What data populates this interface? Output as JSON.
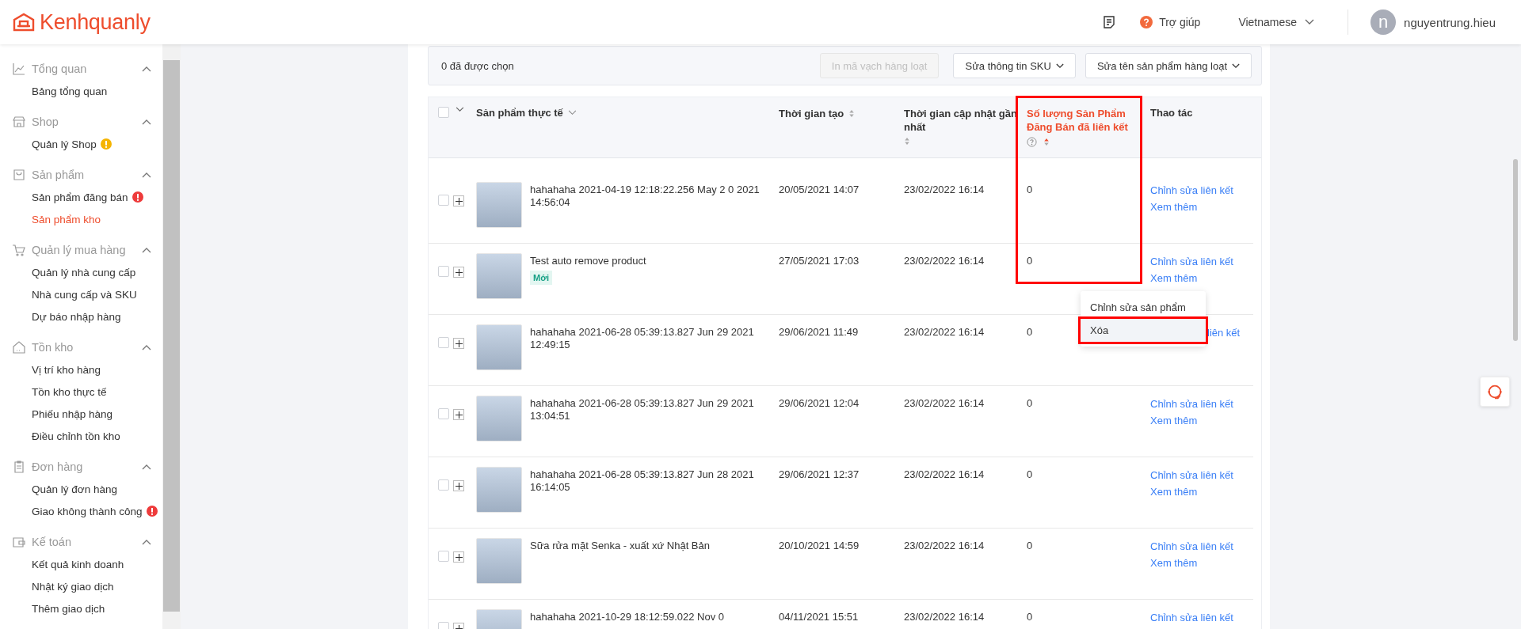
{
  "header": {
    "logo": "Kenhquanly",
    "help": "Trợ giúp",
    "language": "Vietnamese",
    "user": {
      "initial": "n",
      "name": "nguyentrung.hieu"
    }
  },
  "sidebar": {
    "groups": [
      {
        "title": "Tổng quan",
        "kind": "chart",
        "expanded": true,
        "items": [
          {
            "label": "Bảng tổng quan",
            "selected": false
          }
        ]
      },
      {
        "title": "Shop",
        "kind": "shop",
        "expanded": true,
        "items": [
          {
            "label": "Quản lý Shop",
            "selected": false,
            "alert": true,
            "color": "#f5b400"
          }
        ]
      },
      {
        "title": "Sản phẩm",
        "kind": "bag",
        "expanded": true,
        "items": [
          {
            "label": "Sản phẩm đăng bán",
            "selected": false,
            "alert": true,
            "color": "#ee3b3b"
          },
          {
            "label": "Sản phẩm kho",
            "selected": true
          }
        ]
      },
      {
        "title": "Quản lý mua hàng",
        "kind": "cart",
        "expanded": true,
        "items": [
          {
            "label": "Quản lý nhà cung cấp",
            "selected": false
          },
          {
            "label": "Nhà cung cấp và SKU",
            "selected": false
          },
          {
            "label": "Dự báo nhập hàng",
            "selected": false
          }
        ]
      },
      {
        "title": "Tồn kho",
        "kind": "house",
        "expanded": true,
        "items": [
          {
            "label": "Vị trí kho hàng",
            "selected": false
          },
          {
            "label": "Tồn kho thực tế",
            "selected": false
          },
          {
            "label": "Phiếu nhập hàng",
            "selected": false
          },
          {
            "label": "Điều chỉnh tồn kho",
            "selected": false
          }
        ]
      },
      {
        "title": "Đơn hàng",
        "kind": "clipboard",
        "expanded": true,
        "items": [
          {
            "label": "Quản lý đơn hàng",
            "selected": false
          },
          {
            "label": "Giao không thành công",
            "selected": false,
            "alert": true,
            "color": "#ee3b3b"
          }
        ]
      },
      {
        "title": "Kế toán",
        "kind": "wallet",
        "expanded": true,
        "items": [
          {
            "label": "Kết quả kinh doanh",
            "selected": false
          },
          {
            "label": "Nhật ký giao dịch",
            "selected": false
          },
          {
            "label": "Thêm giao dịch",
            "selected": false
          }
        ]
      }
    ]
  },
  "toolbar": {
    "selected_count": "0 đã được chọn",
    "buttons": [
      {
        "label": "In mã vạch hàng loạt",
        "disabled": true,
        "dropdown": false
      },
      {
        "label": "Sửa thông tin SKU",
        "disabled": false,
        "dropdown": true
      },
      {
        "label": "Sửa tên sản phẩm hàng loạt",
        "disabled": false,
        "dropdown": true
      }
    ]
  },
  "table": {
    "select_all": {
      "checked": false
    },
    "columns": [
      {
        "label": "Sản phẩm thực tế",
        "kind": "dropdown",
        "help": false,
        "highlighted": false
      },
      {
        "label": "Thời gian tạo",
        "kind": "sortable",
        "help": false,
        "highlighted": false
      },
      {
        "label": "Thời gian cập nhật gần nhất",
        "kind": "sortable",
        "help": false,
        "highlighted": false
      },
      {
        "label": "Số lượng Sản Phẩm Đăng Bán đã liên kết",
        "kind": "sortable",
        "help": true,
        "highlighted": true
      },
      {
        "label": "Thao tác",
        "kind": "plain",
        "help": false,
        "highlighted": false
      }
    ],
    "rows": [
      {
        "checked": false,
        "name": "hahahaha 2021-04-19 12:18:22.256 May 2 0 2021 14:56:04",
        "created": "20/05/2021 14:07",
        "updated": "23/02/2022 16:14",
        "linked": "0",
        "actions": [
          "Chỉnh sửa liên kết",
          "Xem thêm"
        ]
      },
      {
        "checked": false,
        "name": "Test auto remove product",
        "tag": "Mới",
        "created": "27/05/2021 17:03",
        "updated": "23/02/2022 16:14",
        "linked": "0",
        "actions": [
          "Chỉnh sửa liên kết",
          "Xem thêm"
        ],
        "menu": [
          {
            "label": "Chỉnh sửa sản phẩm",
            "hovered": false,
            "highlighted": false
          },
          {
            "label": "Xóa",
            "hovered": true,
            "highlighted": true
          }
        ]
      },
      {
        "checked": false,
        "name": "hahahaha 2021-06-28 05:39:13.827 Jun 29 2021 12:49:15",
        "created": "29/06/2021 11:49",
        "updated": "23/02/2022 16:14",
        "linked": "0",
        "actions": [
          "liên kết"
        ]
      },
      {
        "checked": false,
        "name": "hahahaha 2021-06-28 05:39:13.827 Jun 29 2021 13:04:51",
        "created": "29/06/2021 12:04",
        "updated": "23/02/2022 16:14",
        "linked": "0",
        "actions": [
          "Chỉnh sửa liên kết",
          "Xem thêm"
        ]
      },
      {
        "checked": false,
        "name": "hahahaha 2021-06-28 05:39:13.827 Jun 28 2021 16:14:05",
        "created": "29/06/2021 12:37",
        "updated": "23/02/2022 16:14",
        "linked": "0",
        "actions": [
          "Chỉnh sửa liên kết",
          "Xem thêm"
        ]
      },
      {
        "checked": false,
        "name": "Sữa rửa mặt Senka - xuất xứ Nhật Bản",
        "created": "20/10/2021 14:59",
        "updated": "23/02/2022 16:14",
        "linked": "0",
        "actions": [
          "Chỉnh sửa liên kết",
          "Xem thêm"
        ]
      },
      {
        "checked": false,
        "name": "hahahaha 2021-10-29 18:12:59.022 Nov 0",
        "created": "04/11/2021 15:51",
        "updated": "23/02/2022 16:14",
        "linked": "0",
        "actions": [
          "Chỉnh sửa liên kết"
        ]
      }
    ]
  }
}
